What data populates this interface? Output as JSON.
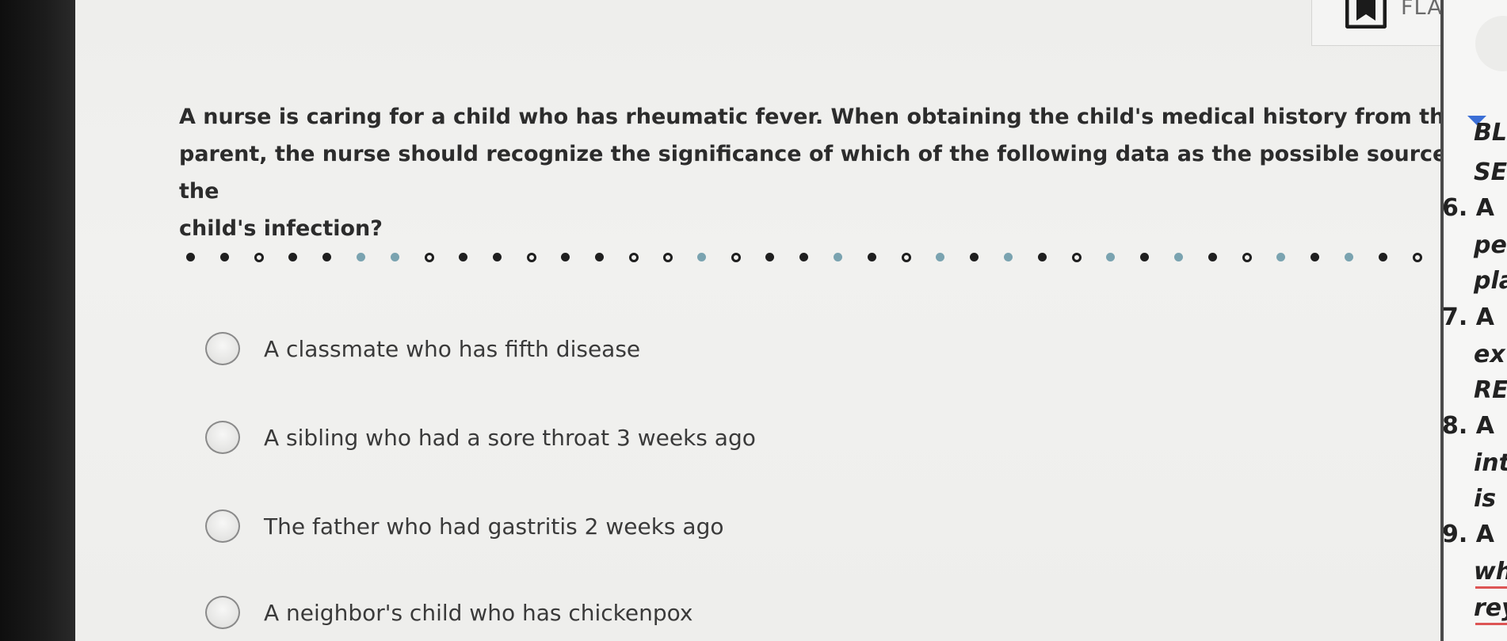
{
  "header": {
    "flag_label": "FLAG"
  },
  "question": {
    "line1": "A nurse is caring for a child who has rheumatic fever. When obtaining the child's medical history from the",
    "line2": "parent, the nurse should recognize the significance of which of the following data as the possible source of the",
    "line3": "child's infection?"
  },
  "progress_dots": [
    "answered",
    "answered",
    "unanswered",
    "answered",
    "answered",
    "current",
    "current",
    "unanswered",
    "answered",
    "answered",
    "unanswered",
    "answered",
    "answered",
    "unanswered",
    "unanswered",
    "current",
    "unanswered",
    "answered",
    "answered",
    "current",
    "answered",
    "unanswered",
    "current",
    "answered",
    "current",
    "answered",
    "unanswered",
    "current",
    "answered",
    "current",
    "answered",
    "unanswered",
    "current",
    "answered",
    "current",
    "answered",
    "unanswered",
    "current",
    "current"
  ],
  "options": [
    {
      "label": "A classmate who has fifth disease"
    },
    {
      "label": "A sibling who had a sore throat 3 weeks ago"
    },
    {
      "label": "The father who had gastritis 2 weeks ago"
    },
    {
      "label": "A neighbor's child who has chickenpox"
    }
  ],
  "side_panel": {
    "lines": [
      "BL",
      "SE",
      "6. A",
      "pe",
      "pla",
      "7. A",
      "ex",
      "RE",
      "8. A",
      "int",
      "is",
      "9. A",
      "wh",
      "rey"
    ]
  },
  "colors": {
    "answered": "#1f1f1f",
    "current": "#7aa3b0",
    "unanswered": "#1f1f1f"
  },
  "icons": {
    "flag": "bookmark-flag-icon",
    "option": "radio-circle-icon"
  }
}
